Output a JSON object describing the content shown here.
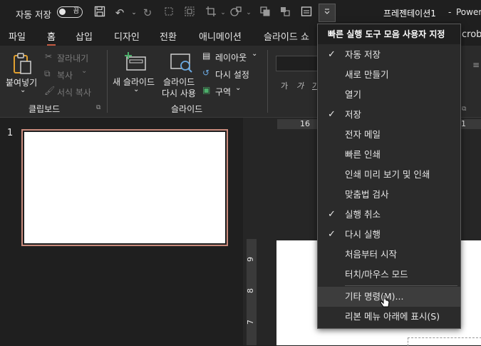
{
  "title_bar": {
    "autosave_label": "자동 저장",
    "autosave_toggle_text": "끔",
    "document_title": "프레젠테이션1",
    "separator": "-",
    "app_name": "PowerP"
  },
  "tabs": [
    {
      "label": "파일"
    },
    {
      "label": "홈"
    },
    {
      "label": "삽입"
    },
    {
      "label": "디자인"
    },
    {
      "label": "전환"
    },
    {
      "label": "애니메이션"
    },
    {
      "label": "슬라이드 쇼"
    },
    {
      "label": "crob"
    }
  ],
  "ribbon": {
    "clipboard": {
      "paste": "붙여넣기",
      "cut": "잘라내기",
      "copy": "복사",
      "format_painter": "서식 복사",
      "group_label": "클립보드"
    },
    "slides": {
      "new_slide_line1": "새 슬라이드",
      "reuse_line1": "슬라이드",
      "reuse_line2": "다시 사용",
      "layout": "레이아웃",
      "reset": "다시 설정",
      "section": "구역",
      "group_label": "슬라이드"
    },
    "font": {
      "bold": "가",
      "italic": "가",
      "underline": "가"
    }
  },
  "thumbnail": {
    "slide_number": "1"
  },
  "ruler": {
    "top_mark_16": "16",
    "top_mark_1": "1",
    "side_marks": [
      "9",
      "8",
      "7"
    ]
  },
  "qat_menu": {
    "title": "빠른 실행 도구 모음 사용자 지정",
    "items": [
      {
        "label": "자동 저장",
        "checked": "✓"
      },
      {
        "label": "새로 만들기",
        "checked": ""
      },
      {
        "label": "열기",
        "checked": ""
      },
      {
        "label": "저장",
        "checked": "✓"
      },
      {
        "label": "전자 메일",
        "checked": ""
      },
      {
        "label": "빠른 인쇄",
        "checked": ""
      },
      {
        "label": "인쇄 미리 보기 및 인쇄",
        "checked": ""
      },
      {
        "label": "맞춤법 검사",
        "checked": ""
      },
      {
        "label": "실행 취소",
        "checked": "✓"
      },
      {
        "label": "다시 실행",
        "checked": "✓"
      },
      {
        "label": "처음부터 시작",
        "checked": ""
      },
      {
        "label": "터치/마우스 모드",
        "checked": ""
      }
    ],
    "more_commands": "기타 명령(M)...",
    "show_below_ribbon": "리본 메뉴 아래에 표시(S)"
  },
  "colors": {
    "accent": "#c55a41",
    "background": "#1f1f1f",
    "ribbon": "#2b2b2b",
    "thumbnail_border": "#c98a7c"
  }
}
